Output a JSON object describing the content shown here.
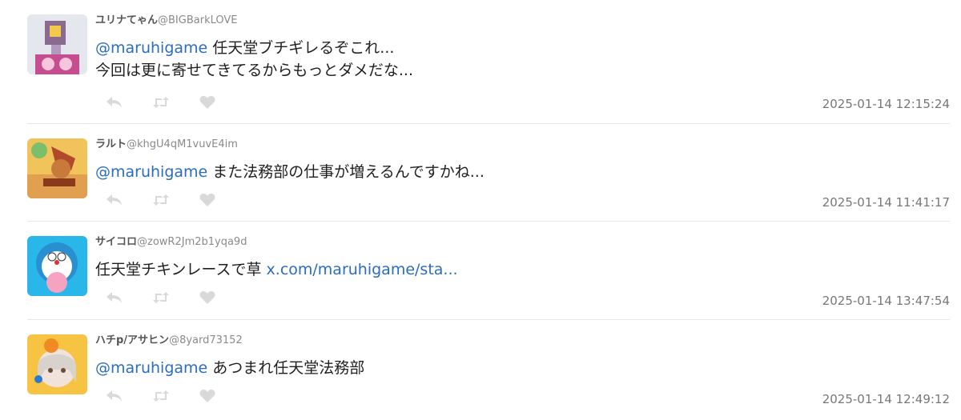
{
  "tweets": [
    {
      "name": "ユリナてゃん",
      "handle": "@BIGBarkLOVE",
      "mention": "@maruhigame",
      "line1": " 任天堂ブチギレるぞこれ...",
      "line2": "今回は更に寄せてきてるからもっとダメだな...",
      "time": "2025-01-14 12:15:24"
    },
    {
      "name": "ラルト",
      "handle": "@khgU4qM1vuvE4im",
      "mention": "@maruhigame",
      "line1": " また法務部の仕事が増えるんですかね...",
      "time": "2025-01-14 11:41:17"
    },
    {
      "name": "サイコロ",
      "handle": "@zowR2Jm2b1yqa9d",
      "line1": "任天堂チキンレースで草 ",
      "link": "x.com/maruhigame/sta...",
      "time": "2025-01-14 13:47:54"
    },
    {
      "name": "ハチp/アサヒン",
      "handle": "@8yard73152",
      "mention": "@maruhigame",
      "line1": " あつまれ任天堂法務部",
      "time": "2025-01-14 12:49:12"
    }
  ],
  "icons": [
    "reply-icon",
    "retweet-icon",
    "like-icon"
  ],
  "colors": {
    "mention": "#2a6dbd",
    "icon": "#d9d9d9",
    "separator": "#e6e6e6"
  }
}
